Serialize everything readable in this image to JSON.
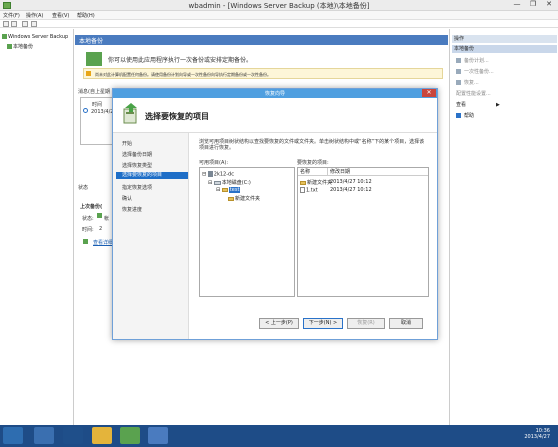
{
  "window": {
    "title": "wbadmin - [Windows Server Backup (本地)\\本地备份]",
    "controls": {
      "minimize": "—",
      "maximize": "❐",
      "close": "✕"
    }
  },
  "menu": {
    "items": [
      "文件(F)",
      "操作(A)",
      "查看(V)",
      "帮助(H)"
    ]
  },
  "tree": {
    "root": "Windows Server Backup",
    "child": "本地备份"
  },
  "main": {
    "header": "本地备份",
    "intro": "你可以使用此应用程序执行一次备份或安排定期备份。",
    "warning": "尚未对此计算机配置任何备份。请使用备份计划向导或一次性备份向导执行定期备份或一次性备份。",
    "messages_label": "消息(自上星期",
    "time_col": "时间",
    "time_value": "2013/4/2",
    "status_label": "状态",
    "last_backup_label": "上次备份(",
    "status_key": "状态:",
    "status_val": "帐",
    "time_key": "时间:",
    "time_val": "2",
    "view_details": "查看详细"
  },
  "actions": {
    "header": "操作",
    "subheader": "本地备份",
    "items": [
      "备份计划...",
      "一次性备份...",
      "恢复...",
      "配置性能设置...",
      "查看",
      "帮助"
    ]
  },
  "dialog": {
    "title": "恢复向导",
    "heading": "选择要恢复的项目",
    "steps": [
      "开始",
      "选择备份日期",
      "选择恢复类型",
      "选择要恢复的项目",
      "指定恢复选项",
      "确认",
      "恢复进度"
    ],
    "active_step": 3,
    "instruction": "浏览可用项目树状结构以查找要恢复的文件或文件夹。单击树状结构中或“名称”下的某个项目，选择该项目进行恢复。",
    "available_label": "可用项目(A):",
    "recover_label": "要恢复的项目:",
    "tree": {
      "server": "2k12-dc",
      "drive": "本地磁盘(C:)",
      "folder_selected": "test",
      "subfolder": "新建文件夹"
    },
    "table": {
      "headers": [
        "名称",
        "修改日期"
      ],
      "rows": [
        {
          "name": "新建文件夹",
          "date": "2013/4/27 10:12"
        },
        {
          "name": "1.txt",
          "date": "2013/4/27 10:12"
        }
      ]
    },
    "buttons": {
      "prev": "< 上一步(P)",
      "next": "下一步(N) >",
      "recover": "恢复(R)",
      "cancel": "取消"
    }
  },
  "taskbar": {
    "time": "10:36",
    "date": "2013/4/27"
  },
  "colors": {
    "dialog_title": "#4f9fe0",
    "active_step": "#1e6ec7",
    "taskbar": "#1e4c87",
    "main_header": "#4a7bbf"
  }
}
